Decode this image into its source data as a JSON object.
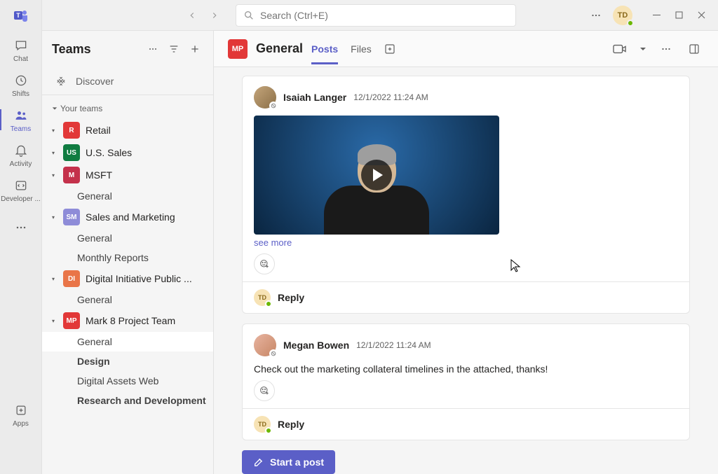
{
  "app": {
    "rail": [
      {
        "label": "Chat"
      },
      {
        "label": "Shifts"
      },
      {
        "label": "Teams"
      },
      {
        "label": "Activity"
      },
      {
        "label": "Developer ..."
      }
    ],
    "apps_label": "Apps"
  },
  "titlebar": {
    "search_placeholder": "Search (Ctrl+E)",
    "user_initials": "TD"
  },
  "teams_panel": {
    "title": "Teams",
    "discover": "Discover",
    "your_teams_label": "Your teams",
    "teams": [
      {
        "initials": "R",
        "name": "Retail",
        "color": "#e23838",
        "channels": []
      },
      {
        "initials": "US",
        "name": "U.S. Sales",
        "color": "#107c41",
        "channels": []
      },
      {
        "initials": "M",
        "name": "MSFT",
        "color": "#c4314b",
        "channels": [
          {
            "name": "General"
          }
        ]
      },
      {
        "initials": "SM",
        "name": "Sales and Marketing",
        "color": "#8e8cd8",
        "channels": [
          {
            "name": "General"
          },
          {
            "name": "Monthly Reports"
          }
        ]
      },
      {
        "initials": "DI",
        "name": "Digital Initiative Public ...",
        "color": "#e97548",
        "channels": [
          {
            "name": "General"
          }
        ]
      },
      {
        "initials": "MP",
        "name": "Mark 8 Project Team",
        "color": "#e23838",
        "channels": [
          {
            "name": "General",
            "selected": true
          },
          {
            "name": "Design",
            "bold": true
          },
          {
            "name": "Digital Assets Web"
          },
          {
            "name": "Research and Development",
            "bold": true
          }
        ]
      }
    ]
  },
  "channel": {
    "avatar_initials": "MP",
    "name": "General",
    "tabs": [
      {
        "label": "Posts",
        "active": true
      },
      {
        "label": "Files"
      }
    ],
    "messages": [
      {
        "author": "Isaiah Langer",
        "time": "12/1/2022 11:24 AM",
        "video": true,
        "see_more": "see more",
        "reply_user": "TD",
        "reply_label": "Reply"
      },
      {
        "author": "Megan Bowen",
        "time": "12/1/2022 11:24 AM",
        "text": "Check out the marketing collateral timelines in the attached, thanks!",
        "reply_user": "TD",
        "reply_label": "Reply"
      }
    ],
    "start_post_label": "Start a post"
  }
}
